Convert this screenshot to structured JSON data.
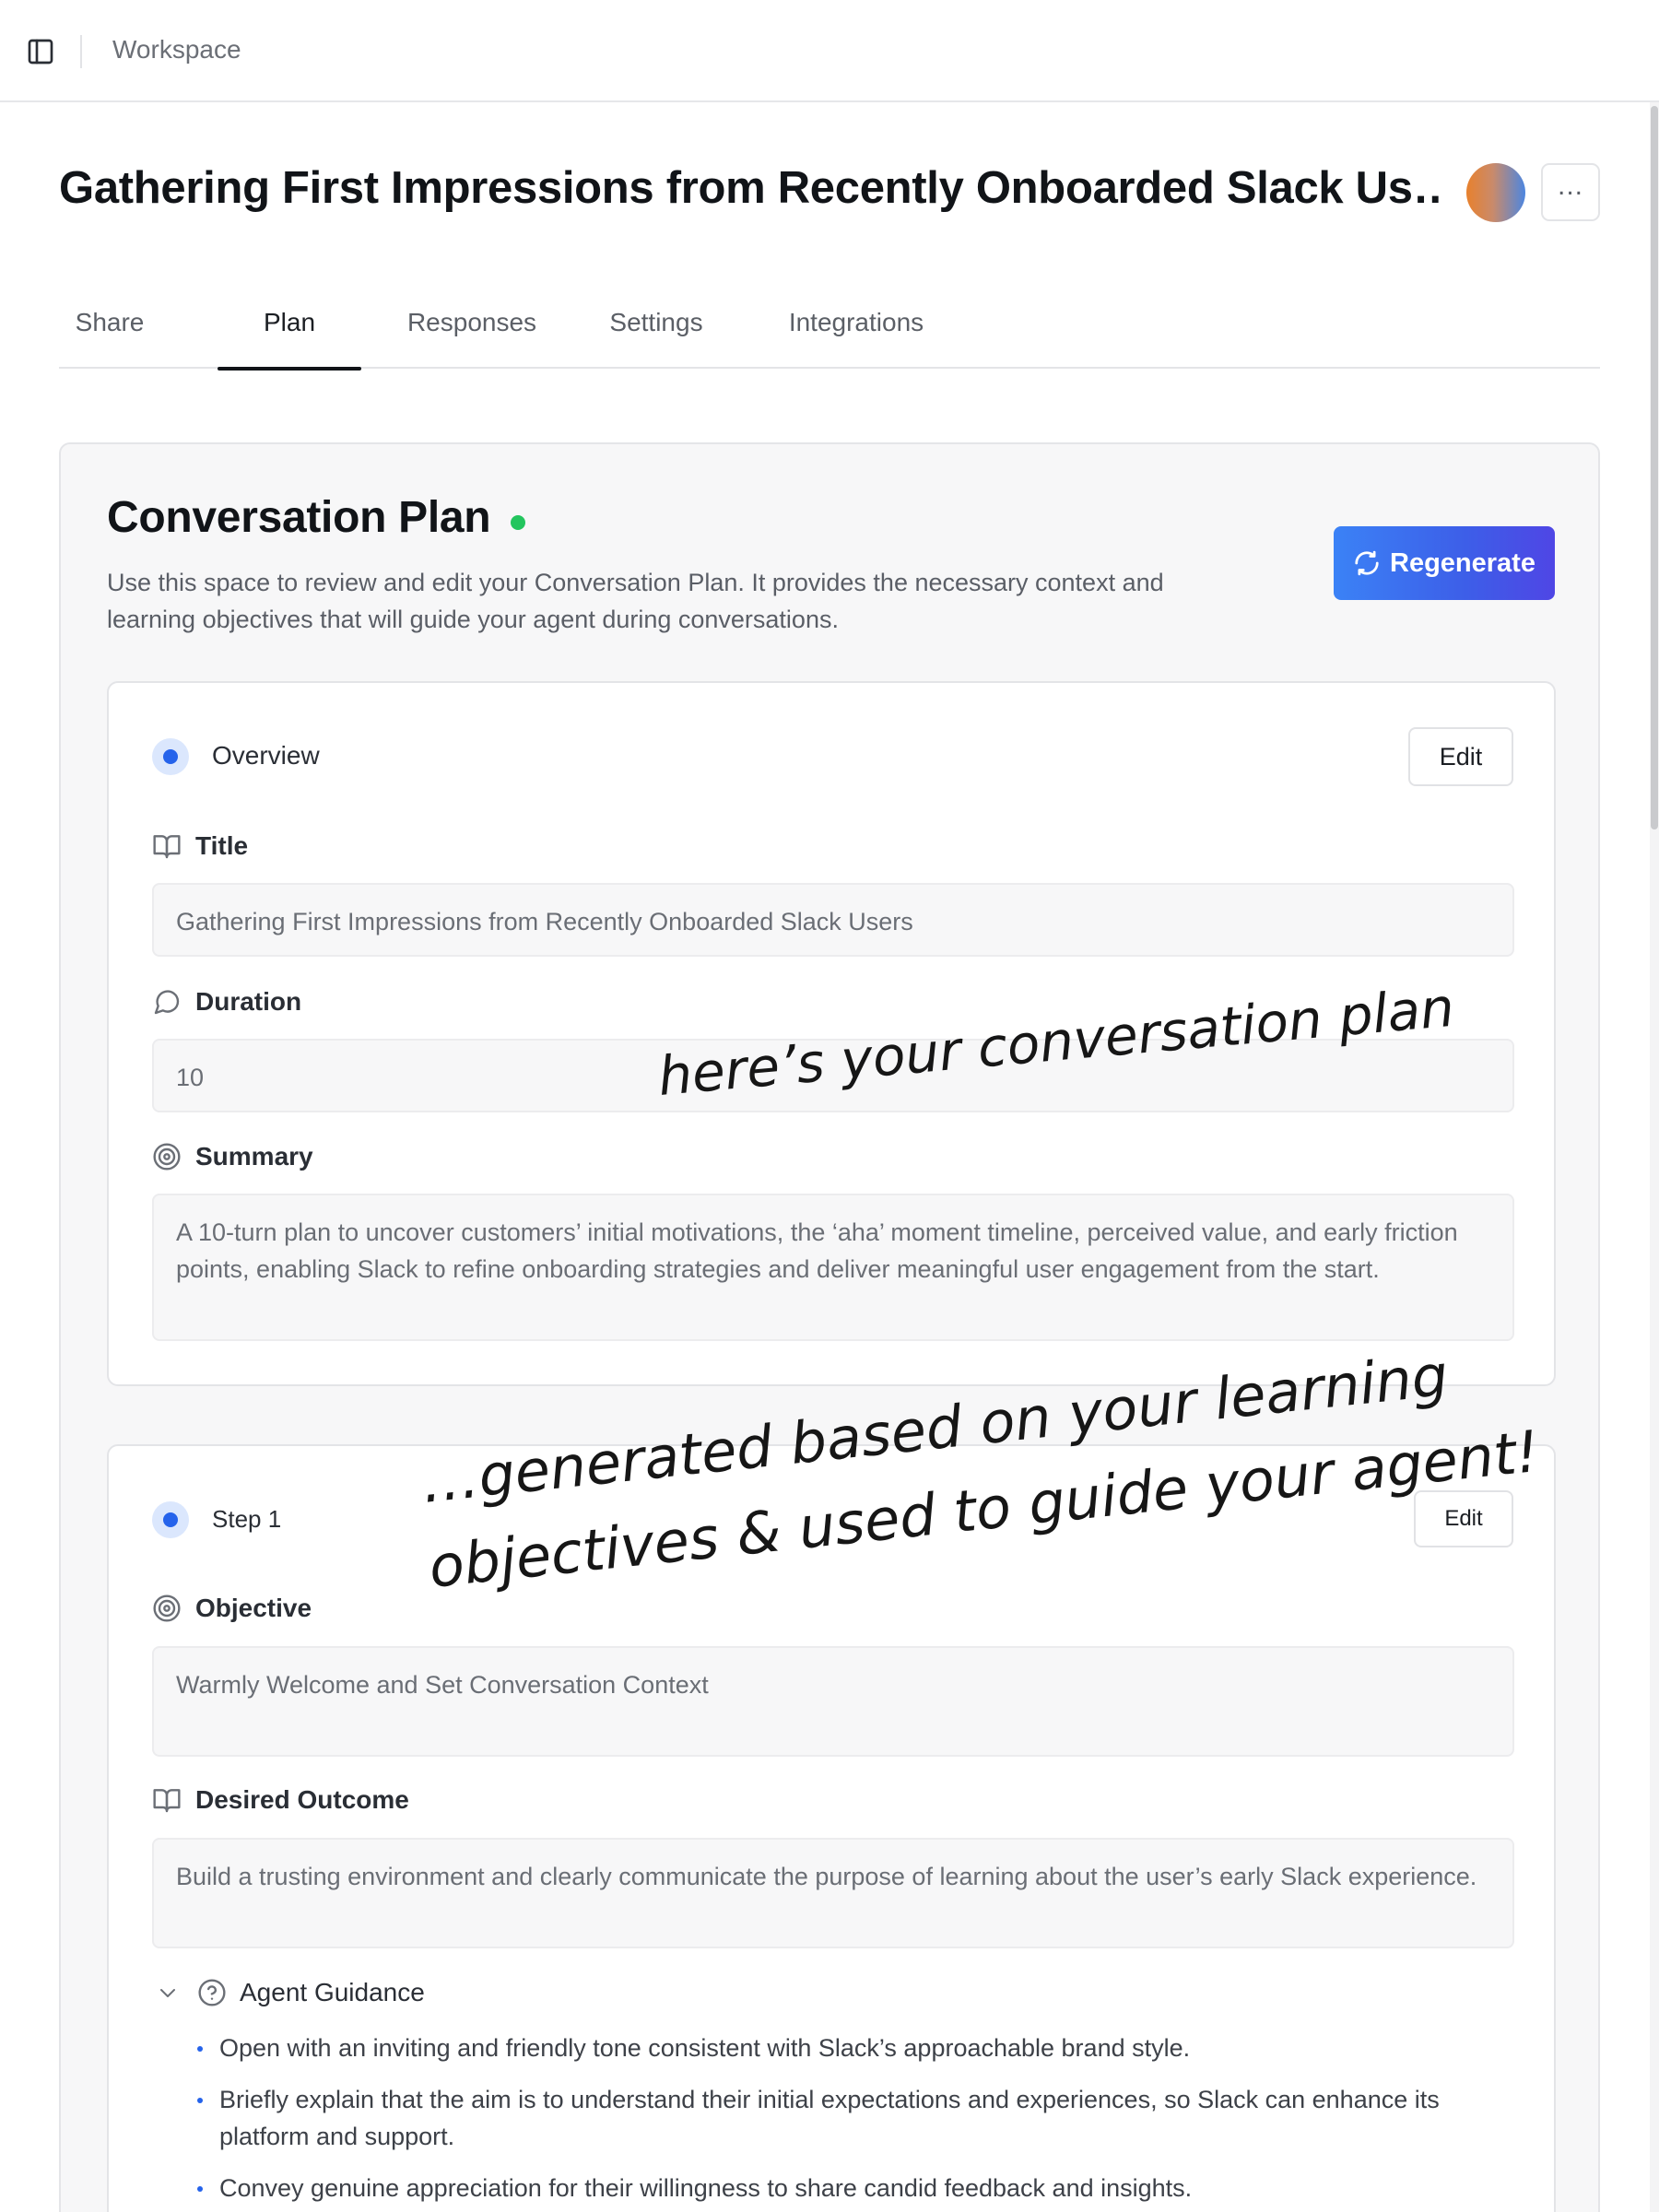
{
  "topbar": {
    "workspace_label": "Workspace"
  },
  "header": {
    "page_title": "Gathering First Impressions from Recently Onboarded Slack Us…"
  },
  "tabs": [
    {
      "label": "Share"
    },
    {
      "label": "Plan",
      "active": true
    },
    {
      "label": "Responses"
    },
    {
      "label": "Settings"
    },
    {
      "label": "Integrations"
    }
  ],
  "plan": {
    "heading": "Conversation Plan",
    "description": "Use this space to review and edit your Conversation Plan. It provides the necessary context and learning objectives that will guide your agent during conversations.",
    "regenerate_label": "Regenerate",
    "status_color": "#23c55e",
    "accent_color": "#3b82f6"
  },
  "overview": {
    "section_label": "Overview",
    "edit_label": "Edit",
    "title_label": "Title",
    "title_value": "Gathering First Impressions from Recently Onboarded Slack Users",
    "duration_label": "Duration",
    "duration_value": "10",
    "summary_label": "Summary",
    "summary_value": "A 10-turn plan to uncover customers’ initial motivations, the ‘aha’ moment timeline, perceived value, and early friction points, enabling Slack to refine onboarding strategies and deliver meaningful user engagement from the start."
  },
  "step1": {
    "section_label": "Step 1",
    "edit_label": "Edit",
    "objective_label": "Objective",
    "objective_value": "Warmly Welcome and Set Conversation Context",
    "outcome_label": "Desired Outcome",
    "outcome_value": "Build a trusting environment and clearly communicate the purpose of learning about the user’s early Slack experience.",
    "guidance_label": "Agent Guidance",
    "guidance_items": [
      "Open with an inviting and friendly tone consistent with Slack’s approachable brand style.",
      "Briefly explain that the aim is to understand their initial expectations and experiences, so Slack can enhance its platform and support.",
      "Convey genuine appreciation for their willingness to share candid feedback and insights."
    ]
  },
  "annotations": {
    "line1": "here’s your conversation plan",
    "line2": "…generated based on your learning",
    "line3": "objectives & used to guide your agent!"
  },
  "icons": {
    "sidebar": "sidebar-toggle-icon",
    "more": "more-horizontal-icon",
    "regenerate": "refresh-icon",
    "title": "book-icon",
    "duration": "message-circle-icon",
    "summary": "target-icon",
    "objective": "target-icon",
    "outcome": "book-icon",
    "guidance": "help-circle-icon",
    "collapse": "chevron-down-icon"
  }
}
